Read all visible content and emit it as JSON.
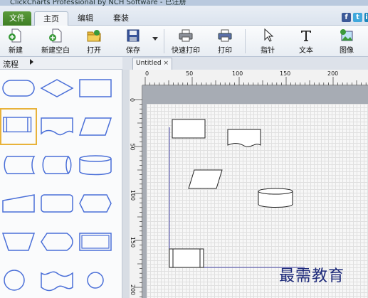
{
  "window": {
    "title": "ClickCharts Professional by NCH Software - 已注册"
  },
  "tabs": [
    "文件",
    "主页",
    "编辑",
    "套装"
  ],
  "social": [
    "f",
    "t",
    "in"
  ],
  "toolbar": {
    "new": "新建",
    "new_blank": "新建空白",
    "open": "打开",
    "save": "保存",
    "quick_print": "快速打印",
    "print": "打印",
    "pointer": "指针",
    "text": "文本",
    "image": "图像"
  },
  "side_panel": {
    "category": "流程"
  },
  "document": {
    "tab_title": "Untitled",
    "close": "×"
  },
  "rulers": {
    "horizontal": [
      "0",
      "50",
      "100",
      "150",
      "200"
    ],
    "vertical": [
      "0",
      "50",
      "100",
      "150",
      "200"
    ]
  },
  "watermark": "最需教育",
  "colors": {
    "shape_stroke": "#4a6fd8",
    "file_tab": "#4a8a2e",
    "selection": "#e8b23a",
    "connector": "#4040a0"
  }
}
